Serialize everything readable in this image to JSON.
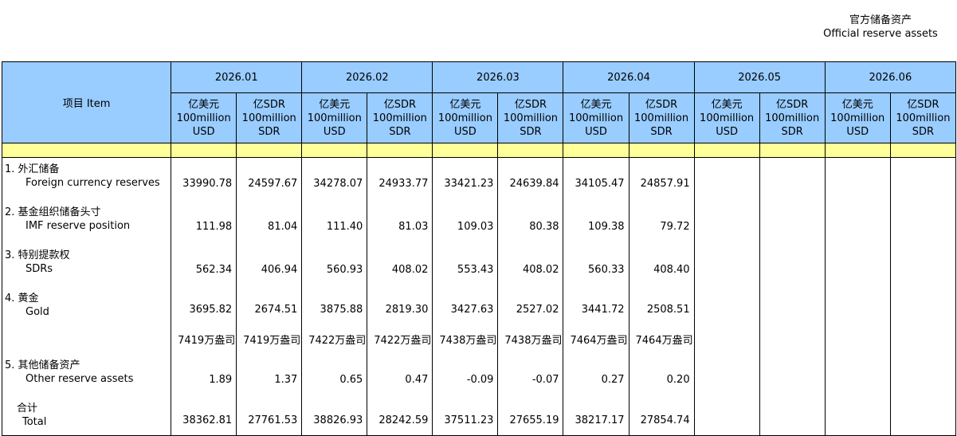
{
  "title": {
    "zh": "官方储备资产",
    "en": "Official reserve assets"
  },
  "header": {
    "item_label": "项目  Item",
    "months": [
      "2026.01",
      "2026.02",
      "2026.03",
      "2026.04",
      "2026.05",
      "2026.06"
    ],
    "unit_usd": [
      "亿美元",
      "100million",
      "USD"
    ],
    "unit_sdr": [
      "亿SDR",
      "100million",
      "SDR"
    ]
  },
  "rows": [
    {
      "zh": "1.  外汇储备",
      "en": "Foreign currency reserves",
      "values": [
        "33990.78",
        "24597.67",
        "34278.07",
        "24933.77",
        "33421.23",
        "24639.84",
        "34105.47",
        "24857.91",
        "",
        "",
        "",
        ""
      ]
    },
    {
      "zh": "2.  基金组织储备头寸",
      "en": "IMF reserve position",
      "values": [
        "111.98",
        "81.04",
        "111.40",
        "81.03",
        "109.03",
        "80.38",
        "109.38",
        "79.72",
        "",
        "",
        "",
        ""
      ]
    },
    {
      "zh": "3.  特别提款权",
      "en": "SDRs",
      "values": [
        "562.34",
        "406.94",
        "560.93",
        "408.02",
        "553.43",
        "408.02",
        "560.33",
        "408.40",
        "",
        "",
        "",
        ""
      ]
    },
    {
      "zh": "4.  黄金",
      "en": "Gold",
      "values": [
        "3695.82",
        "2674.51",
        "3875.88",
        "2819.30",
        "3427.63",
        "2527.02",
        "3441.72",
        "2508.51",
        "",
        "",
        "",
        ""
      ]
    },
    {
      "zh": "",
      "en": "",
      "values": [
        "7419万盎司",
        "7419万盎司",
        "7422万盎司",
        "7422万盎司",
        "7438万盎司",
        "7438万盎司",
        "7464万盎司",
        "7464万盎司",
        "",
        "",
        "",
        ""
      ]
    },
    {
      "zh": "5.  其他储备资产",
      "en": "Other reserve assets",
      "values": [
        "1.89",
        "1.37",
        "0.65",
        "0.47",
        "-0.09",
        "-0.07",
        "0.27",
        "0.20",
        "",
        "",
        "",
        ""
      ]
    },
    {
      "zh": "合计",
      "en": "Total",
      "values": [
        "38362.81",
        "27761.53",
        "38826.93",
        "28242.59",
        "37511.23",
        "27655.19",
        "38217.17",
        "27854.74",
        "",
        "",
        "",
        ""
      ]
    }
  ]
}
